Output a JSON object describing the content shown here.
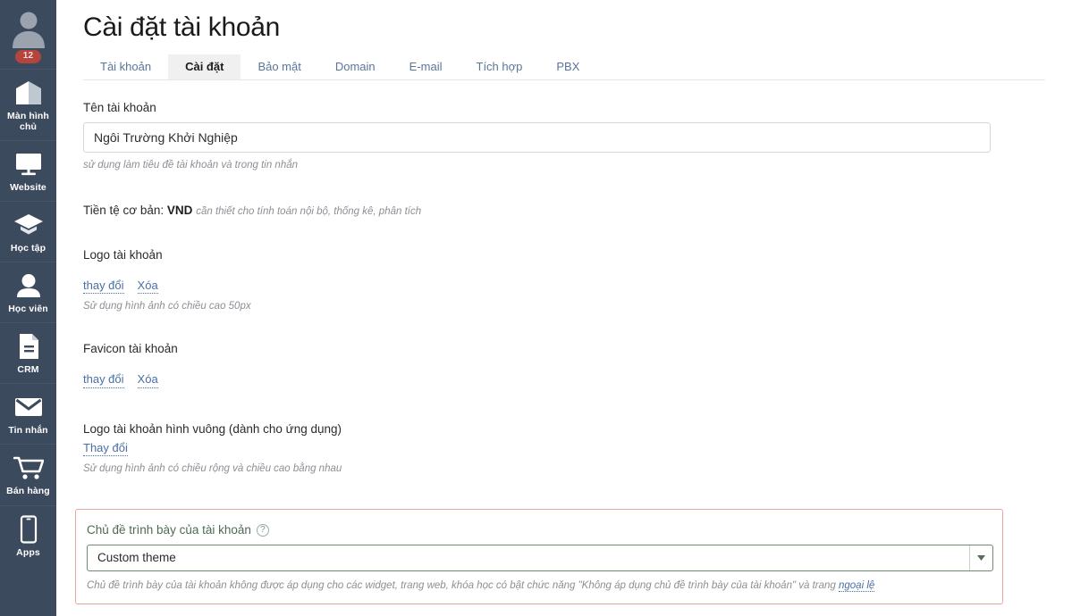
{
  "sidebar": {
    "avatar": {
      "icon": "user-avatar-icon"
    },
    "badge": "12",
    "items": [
      {
        "label": "Màn hình chủ",
        "icon": "home-icon"
      },
      {
        "label": "Website",
        "icon": "monitor-icon"
      },
      {
        "label": "Học tập",
        "icon": "graduation-cap-icon"
      },
      {
        "label": "Học viên",
        "icon": "student-person-icon"
      },
      {
        "label": "CRM",
        "icon": "document-icon"
      },
      {
        "label": "Tin nhắn",
        "icon": "envelope-icon"
      },
      {
        "label": "Bán hàng",
        "icon": "shopping-cart-icon"
      },
      {
        "label": "Apps",
        "icon": "mobile-phone-icon"
      }
    ]
  },
  "header": {
    "title": "Cài đặt tài khoản"
  },
  "tabs": [
    {
      "label": "Tài khoản",
      "active": false
    },
    {
      "label": "Cài đặt",
      "active": true
    },
    {
      "label": "Bảo mật",
      "active": false
    },
    {
      "label": "Domain",
      "active": false
    },
    {
      "label": "E-mail",
      "active": false
    },
    {
      "label": "Tích hợp",
      "active": false
    },
    {
      "label": "PBX",
      "active": false
    }
  ],
  "account_name": {
    "label": "Tên tài khoản",
    "value": "Ngôi Trường Khởi Nghiệp",
    "placeholder": "Tên tài khoản",
    "hint": "sử dụng làm tiêu đề tài khoản và trong tin nhắn"
  },
  "currency": {
    "label": "Tiền tệ cơ bản:",
    "code": "VND",
    "note": "cần thiết cho tính toán nội bộ, thống kê, phân tích"
  },
  "logo": {
    "heading": "Logo tài khoản",
    "change_label": "thay đổi",
    "delete_label": "Xóa",
    "hint": "Sử dụng hình ảnh có chiều cao 50px"
  },
  "favicon": {
    "heading": "Favicon tài khoản",
    "change_label": "thay đổi",
    "delete_label": "Xóa"
  },
  "square_logo": {
    "heading": "Logo tài khoản hình vuông (dành cho ứng dụng)",
    "change_label": "Thay đổi",
    "hint": "Sử dụng hình ảnh có chiều rộng và chiều cao bằng nhau"
  },
  "theme": {
    "label": "Chủ đề trình bày của tài khoản",
    "help_icon": "question-mark-icon",
    "selected": "Custom theme",
    "options": [
      "Custom theme"
    ],
    "hint_before": "Chủ đề trình bày của tài khoản không được áp dụng cho các widget, trang web, khóa học có bật chức năng \"Không áp dụng chủ đề trình bày của tài khoản\" và trang ",
    "hint_link": "ngoại lệ"
  },
  "colors": {
    "sidebar_bg": "#3c4a5e",
    "badge_bg": "#b5453c",
    "link_blue": "#4a6fa5",
    "tab_blue": "#5a7699",
    "panel_border_red": "#e8a49e",
    "select_border_green": "#6f8a70",
    "theme_label_green": "#4f6a54"
  }
}
